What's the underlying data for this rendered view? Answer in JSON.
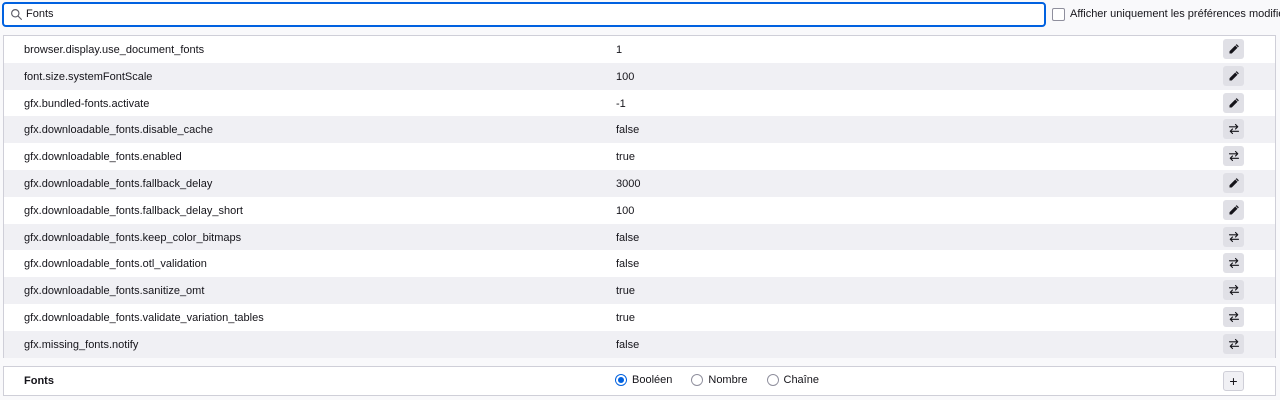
{
  "search": {
    "value": "Fonts"
  },
  "filter": {
    "label": "Afficher uniquement les préférences modifiées",
    "checked": false
  },
  "prefs": [
    {
      "name": "browser.display.use_document_fonts",
      "value": "1",
      "action": "edit-icon"
    },
    {
      "name": "font.size.systemFontScale",
      "value": "100",
      "action": "edit-icon"
    },
    {
      "name": "gfx.bundled-fonts.activate",
      "value": "-1",
      "action": "edit-icon"
    },
    {
      "name": "gfx.downloadable_fonts.disable_cache",
      "value": "false",
      "action": "toggle-icon"
    },
    {
      "name": "gfx.downloadable_fonts.enabled",
      "value": "true",
      "action": "toggle-icon"
    },
    {
      "name": "gfx.downloadable_fonts.fallback_delay",
      "value": "3000",
      "action": "edit-icon"
    },
    {
      "name": "gfx.downloadable_fonts.fallback_delay_short",
      "value": "100",
      "action": "edit-icon"
    },
    {
      "name": "gfx.downloadable_fonts.keep_color_bitmaps",
      "value": "false",
      "action": "toggle-icon"
    },
    {
      "name": "gfx.downloadable_fonts.otl_validation",
      "value": "false",
      "action": "toggle-icon"
    },
    {
      "name": "gfx.downloadable_fonts.sanitize_omt",
      "value": "true",
      "action": "toggle-icon"
    },
    {
      "name": "gfx.downloadable_fonts.validate_variation_tables",
      "value": "true",
      "action": "toggle-icon"
    },
    {
      "name": "gfx.missing_fonts.notify",
      "value": "false",
      "action": "toggle-icon"
    }
  ],
  "new_pref": {
    "name": "Fonts",
    "types": [
      {
        "label": "Booléen",
        "checked": true
      },
      {
        "label": "Nombre",
        "checked": false
      },
      {
        "label": "Chaîne",
        "checked": false
      }
    ],
    "add_icon": "plus-icon"
  },
  "colors": {
    "accent": "#0061e0",
    "row_alt": "#f0f0f4",
    "button_bg": "#e0e0e6"
  }
}
